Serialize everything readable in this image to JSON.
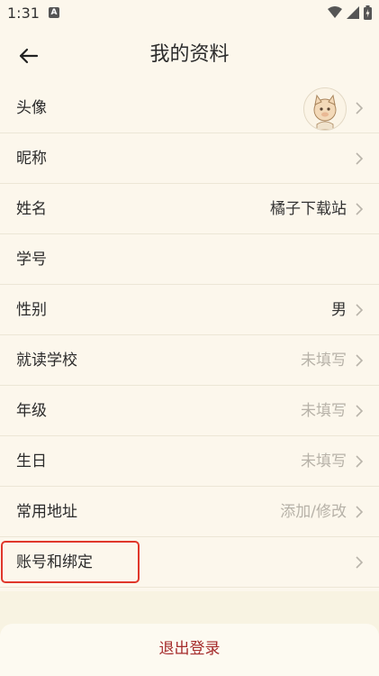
{
  "status_bar": {
    "time": "1:31",
    "sim_label": "A"
  },
  "header": {
    "title": "我的资料"
  },
  "rows": [
    {
      "label": "头像",
      "value": "",
      "type": "avatar"
    },
    {
      "label": "昵称",
      "value": ""
    },
    {
      "label": "姓名",
      "value": "橘子下载站"
    },
    {
      "label": "学号",
      "value": ""
    },
    {
      "label": "性别",
      "value": "男"
    },
    {
      "label": "就读学校",
      "value": "未填写",
      "placeholder": true
    },
    {
      "label": "年级",
      "value": "未填写",
      "placeholder": true
    },
    {
      "label": "生日",
      "value": "未填写",
      "placeholder": true
    },
    {
      "label": "常用地址",
      "value": "添加/修改",
      "placeholder": true
    },
    {
      "label": "账号和绑定",
      "value": ""
    }
  ],
  "logout": {
    "label": "退出登录"
  },
  "colors": {
    "background": "#fcf7ec",
    "divider": "#ece6d6",
    "placeholder_text": "#b7b2a8",
    "logout_text": "#a52b2b",
    "highlight": "#e0372b"
  }
}
